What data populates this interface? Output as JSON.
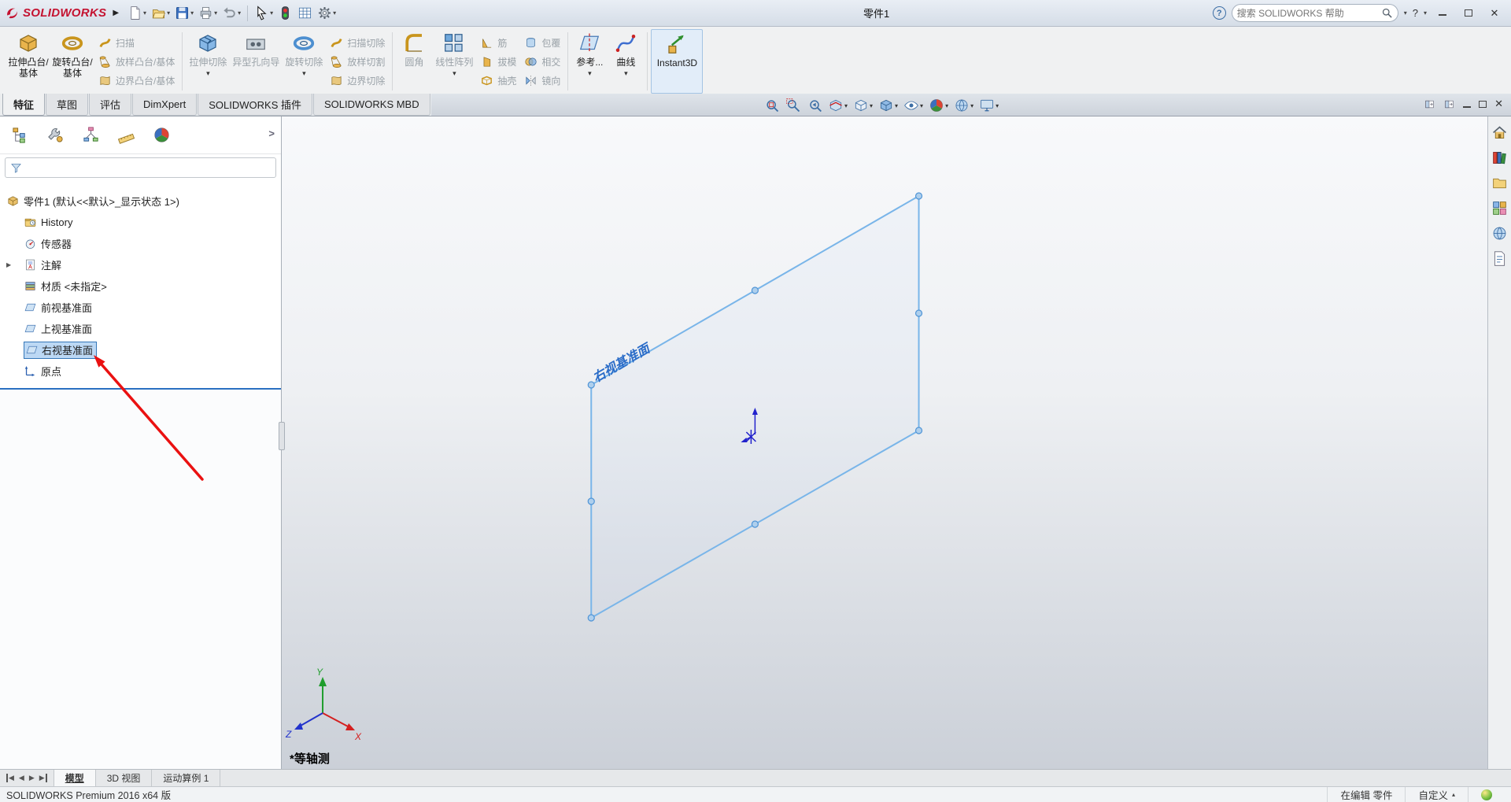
{
  "titlebar": {
    "brand": "SOLIDWORKS",
    "title": "零件1",
    "search_placeholder": "搜索 SOLIDWORKS 帮助",
    "help_label": "?"
  },
  "quick_toolbar_icons": [
    "new-document",
    "open",
    "save",
    "print",
    "undo",
    "select-cursor",
    "rebuild",
    "display-settings",
    "options"
  ],
  "ribbon": {
    "buttons": {
      "extrude_boss": "拉伸凸台/基体",
      "revolve_boss": "旋转凸台/基体",
      "sweep": "扫描",
      "loft": "放样凸台/基体",
      "boundary": "边界凸台/基体",
      "extrude_cut": "拉伸切除",
      "hole_wizard": "异型孔向导",
      "revolve_cut": "旋转切除",
      "sweep_cut": "扫描切除",
      "loft_cut": "放样切割",
      "boundary_cut": "边界切除",
      "fillet": "圆角",
      "linear_pattern": "线性阵列",
      "rib": "筋",
      "draft": "拔模",
      "shell": "抽壳",
      "wrap": "包覆",
      "intersect": "相交",
      "mirror": "镜向",
      "reference_geometry": "参考...",
      "curves": "曲线",
      "instant3d": "Instant3D"
    }
  },
  "command_tabs": [
    "特征",
    "草图",
    "评估",
    "DimXpert",
    "SOLIDWORKS 插件",
    "SOLIDWORKS MBD"
  ],
  "headsup_icons": [
    "zoom-to-fit",
    "zoom-to-area",
    "previous-view",
    "section-view",
    "view-orientation",
    "display-style",
    "hide-show-items",
    "edit-appearance",
    "apply-scene",
    "view-settings"
  ],
  "feature_tree": {
    "root": "零件1 (默认<<默认>_显示状态 1>)",
    "items": [
      {
        "label": "History"
      },
      {
        "label": "传感器"
      },
      {
        "label": "注解"
      },
      {
        "label": "材质 <未指定>"
      },
      {
        "label": "前视基准面"
      },
      {
        "label": "上视基准面"
      },
      {
        "label": "右视基准面"
      },
      {
        "label": "原点"
      }
    ],
    "selected_item": "右视基准面"
  },
  "viewport": {
    "plane_label": "右视基准面",
    "view_orientation": "*等轴测",
    "triad_axes": {
      "x": "X",
      "y": "Y",
      "z": "Z"
    }
  },
  "taskpane_icons": [
    "solidworks-resources",
    "design-library",
    "file-explorer",
    "view-palette",
    "appearances",
    "custom-properties"
  ],
  "bottom_tabs": [
    "模型",
    "3D 视图",
    "运动算例 1"
  ],
  "statusbar": {
    "product": "SOLIDWORKS Premium 2016 x64 版",
    "editing_state": "在编辑 零件",
    "units": "自定义"
  },
  "colors": {
    "selection_blue": "#3577b8",
    "plane_edge": "#79b5e9",
    "annotation_red": "#ea1111",
    "axis_x_red": "#d42020",
    "axis_y_green": "#1f9d2c",
    "axis_z_blue": "#2233cc"
  }
}
